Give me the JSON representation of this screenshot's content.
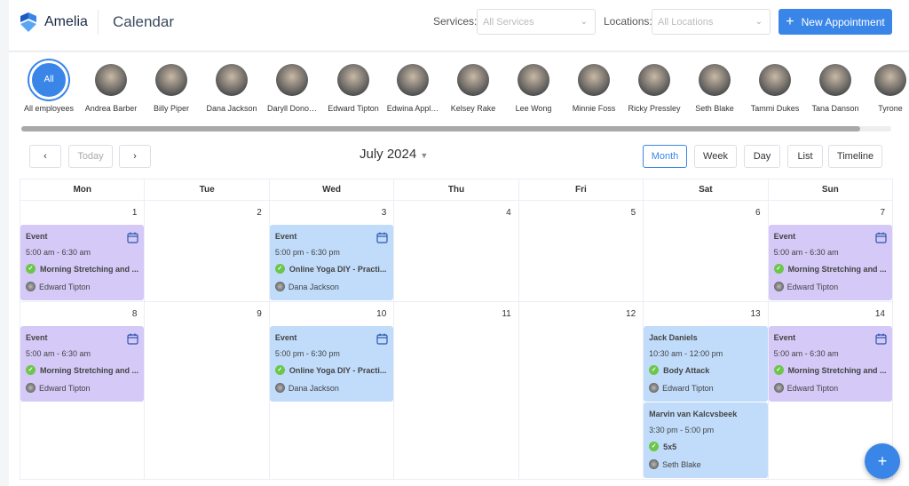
{
  "header": {
    "app_name": "Amelia",
    "title": "Calendar",
    "services_label": "Services:",
    "services_placeholder": "All Services",
    "locations_label": "Locations:",
    "locations_placeholder": "All Locations",
    "new_appointment": "New Appointment"
  },
  "employees": [
    {
      "name": "All employees",
      "initials": "All"
    },
    {
      "name": "Andrea Barber"
    },
    {
      "name": "Billy Piper"
    },
    {
      "name": "Dana Jackson"
    },
    {
      "name": "Daryll Dono…"
    },
    {
      "name": "Edward Tipton"
    },
    {
      "name": "Edwina Appl…"
    },
    {
      "name": "Kelsey Rake"
    },
    {
      "name": "Lee Wong"
    },
    {
      "name": "Minnie Foss"
    },
    {
      "name": "Ricky Pressley"
    },
    {
      "name": "Seth Blake"
    },
    {
      "name": "Tammi Dukes"
    },
    {
      "name": "Tana Danson"
    },
    {
      "name": "Tyrone"
    }
  ],
  "toolbar": {
    "prev": "‹",
    "today": "Today",
    "next": "›",
    "month_label": "July 2024",
    "views": [
      "Month",
      "Week",
      "Day",
      "List",
      "Timeline"
    ],
    "active_view": "Month"
  },
  "weekdays": [
    "Mon",
    "Tue",
    "Wed",
    "Thu",
    "Fri",
    "Sat",
    "Sun"
  ],
  "weeks": [
    {
      "days": [
        {
          "date": "1",
          "events": [
            {
              "title": "Event",
              "time": "5:00 am - 6:30 am",
              "service": "Morning Stretching and ...",
              "employee": "Edward Tipton",
              "color": "purple",
              "icon": "calendar-icon"
            }
          ]
        },
        {
          "date": "2",
          "events": []
        },
        {
          "date": "3",
          "events": [
            {
              "title": "Event",
              "time": "5:00 pm - 6:30 pm",
              "service": "Online Yoga DIY - Practi...",
              "employee": "Dana Jackson",
              "color": "blue",
              "icon": "calendar-icon"
            }
          ]
        },
        {
          "date": "4",
          "events": []
        },
        {
          "date": "5",
          "events": []
        },
        {
          "date": "6",
          "events": []
        },
        {
          "date": "7",
          "events": [
            {
              "title": "Event",
              "time": "5:00 am - 6:30 am",
              "service": "Morning Stretching and ...",
              "employee": "Edward Tipton",
              "color": "purple",
              "icon": "calendar-icon"
            }
          ]
        }
      ]
    },
    {
      "days": [
        {
          "date": "8",
          "events": [
            {
              "title": "Event",
              "time": "5:00 am - 6:30 am",
              "service": "Morning Stretching and ...",
              "employee": "Edward Tipton",
              "color": "purple",
              "icon": "calendar-icon"
            }
          ]
        },
        {
          "date": "9",
          "events": []
        },
        {
          "date": "10",
          "events": [
            {
              "title": "Event",
              "time": "5:00 pm - 6:30 pm",
              "service": "Online Yoga DIY - Practi...",
              "employee": "Dana Jackson",
              "color": "blue",
              "icon": "calendar-icon"
            }
          ]
        },
        {
          "date": "11",
          "events": []
        },
        {
          "date": "12",
          "events": []
        },
        {
          "date": "13",
          "events": [
            {
              "title": "Jack Daniels",
              "time": "10:30 am - 12:00 pm",
              "service": "Body Attack",
              "employee": "Edward Tipton",
              "color": "blue"
            },
            {
              "title": "Marvin van Kalcvsbeek",
              "time": "3:30 pm - 5:00 pm",
              "service": "5x5",
              "employee": "Seth Blake",
              "color": "blue"
            }
          ]
        },
        {
          "date": "14",
          "events": [
            {
              "title": "Event",
              "time": "5:00 am - 6:30 am",
              "service": "Morning Stretching and ...",
              "employee": "Edward Tipton",
              "color": "purple",
              "icon": "calendar-icon"
            }
          ]
        }
      ]
    }
  ],
  "fab": "+",
  "colors": {
    "accent": "#3a86e8",
    "event_purple": "#d4c9f7",
    "event_blue": "#c0dcfa",
    "approved": "#6cc64a"
  }
}
